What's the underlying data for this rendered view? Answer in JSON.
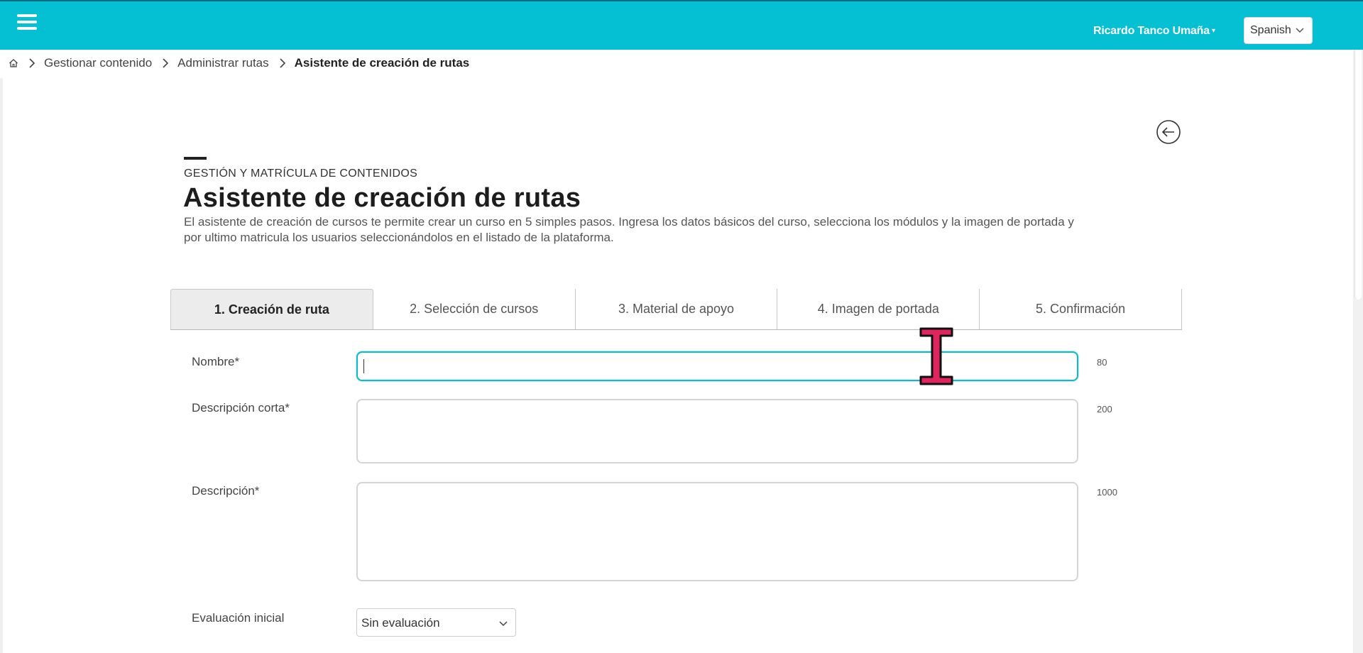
{
  "header": {
    "user_name": "Ricardo Tanco Umaña",
    "user_caret": "▾",
    "language": "Spanish"
  },
  "breadcrumb": {
    "items": [
      "Gestionar contenido",
      "Administrar rutas"
    ],
    "current": "Asistente de creación de rutas"
  },
  "page": {
    "eyebrow": "GESTIÓN Y MATRÍCULA DE CONTENIDOS",
    "title": "Asistente de creación de rutas",
    "description": "El asistente de creación de cursos te permite crear un curso en 5 simples pasos. Ingresa los datos básicos del curso, selecciona los módulos y la imagen de portada y por ultimo matricula los usuarios seleccionándolos en el listado de la plataforma."
  },
  "tabs": [
    {
      "label": "1. Creación de ruta",
      "active": true
    },
    {
      "label": "2. Selección de cursos",
      "active": false
    },
    {
      "label": "3. Material de apoyo",
      "active": false
    },
    {
      "label": "4. Imagen de portada",
      "active": false
    },
    {
      "label": "5. Confirmación",
      "active": false
    }
  ],
  "form": {
    "name": {
      "label": "Nombre*",
      "value": "",
      "counter": "80"
    },
    "short_desc": {
      "label": "Descripción corta*",
      "value": "",
      "counter": "200"
    },
    "desc": {
      "label": "Descripción*",
      "value": "",
      "counter": "1000"
    },
    "eval": {
      "label": "Evaluación inicial",
      "selected": "Sin evaluación"
    }
  },
  "colors": {
    "topbar": "#05bfd3",
    "focus_border": "#11b8cb",
    "cursor_fill": "#e0245e"
  },
  "icons": {
    "menu": "hamburger-icon",
    "home": "home-icon",
    "separator": "chevron-right-icon",
    "back": "arrow-left-circle-icon",
    "dropdown": "chevron-down-icon",
    "mouse": "text-cursor-icon"
  }
}
